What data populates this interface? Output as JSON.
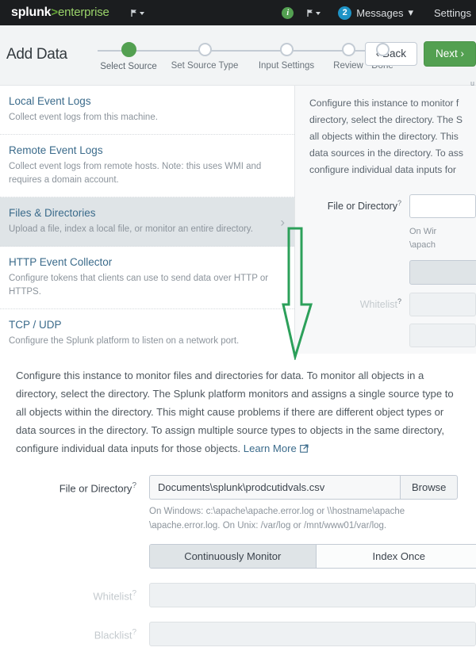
{
  "navbar": {
    "logo": {
      "brand": "splunk",
      "separator": ">",
      "product": "enterprise"
    },
    "flag_icon": "flag-icon",
    "info_icon": "info-icon",
    "info_glyph": "i",
    "activity_icon": "flag-icon",
    "messages": {
      "count": "2",
      "label": "Messages",
      "caret": "▾"
    },
    "settings": "Settings"
  },
  "wizard": {
    "title": "Add Data",
    "steps": [
      {
        "label": "Select Source",
        "state": "active"
      },
      {
        "label": "Set Source Type",
        "state": "pending"
      },
      {
        "label": "Input Settings",
        "state": "pending"
      },
      {
        "label": "Review",
        "state": "pending"
      },
      {
        "label": "Done",
        "state": "pending"
      }
    ],
    "back_label": "‹ Back",
    "next_label": "Next ›",
    "edge_fragment": "u"
  },
  "source_list": [
    {
      "title": "Local Event Logs",
      "desc": "Collect event logs from this machine.",
      "selected": false
    },
    {
      "title": "Remote Event Logs",
      "desc": "Collect event logs from remote hosts. Note: this uses WMI and requires a domain account.",
      "selected": false
    },
    {
      "title": "Files & Directories",
      "desc": "Upload a file, index a local file, or monitor an entire directory.",
      "selected": true,
      "chevron": "›"
    },
    {
      "title": "HTTP Event Collector",
      "desc": "Configure tokens that clients can use to send data over HTTP or HTTPS.",
      "selected": false
    },
    {
      "title": "TCP / UDP",
      "desc": "Configure the Splunk platform to listen on a network port.",
      "selected": false
    }
  ],
  "right_config": {
    "paragraph_lines": [
      "Configure this instance to monitor f",
      "directory, select the directory. The S",
      "all objects within the directory. This",
      "data sources in the directory. To ass",
      "configure individual data inputs for"
    ],
    "file_or_directory_label": "File or Directory",
    "help_marker": "?",
    "hint_lines": [
      "On Wir",
      "\\apach"
    ],
    "whitelist_label": "Whitelist"
  },
  "detail": {
    "paragraph": "Configure this instance to monitor files and directories for data. To monitor all objects in a directory, select the directory. The Splunk platform monitors and assigns a single source type to all objects within the directory. This might cause problems if there are different object types or data sources in the directory. To assign multiple source types to objects in the same directory, configure individual data inputs for those objects.",
    "learn_more": "Learn More",
    "external_link_icon": "external-link-icon",
    "file_or_directory_label": "File or Directory",
    "help_marker": "?",
    "file_value": "Documents\\splunk\\prodcutidvals.csv",
    "file_placeholder": "",
    "browse_label": "Browse",
    "hint_line1": "On Windows: c:\\apache\\apache.error.log or \\\\hostname\\apache",
    "hint_line2": "\\apache.error.log. On Unix: /var/log or /mnt/www01/var/log.",
    "toggle": {
      "continuously_monitor": "Continuously Monitor",
      "index_once": "Index Once",
      "selected": "Continuously Monitor"
    },
    "whitelist_label": "Whitelist",
    "whitelist_value": "",
    "blacklist_label": "Blacklist",
    "blacklist_value": ""
  },
  "annotation": {
    "arrow_icon": "down-arrow-annotation",
    "color": "#2ca05a"
  },
  "colors": {
    "navbar_bg": "#1b1d1f",
    "accent_green": "#53a051",
    "link_blue": "#3b6b8b",
    "badge_blue": "#1e93c6",
    "panel_bg": "#f2f4f5",
    "selected_row": "#dfe4e7",
    "annotation_green": "#2ca05a"
  }
}
